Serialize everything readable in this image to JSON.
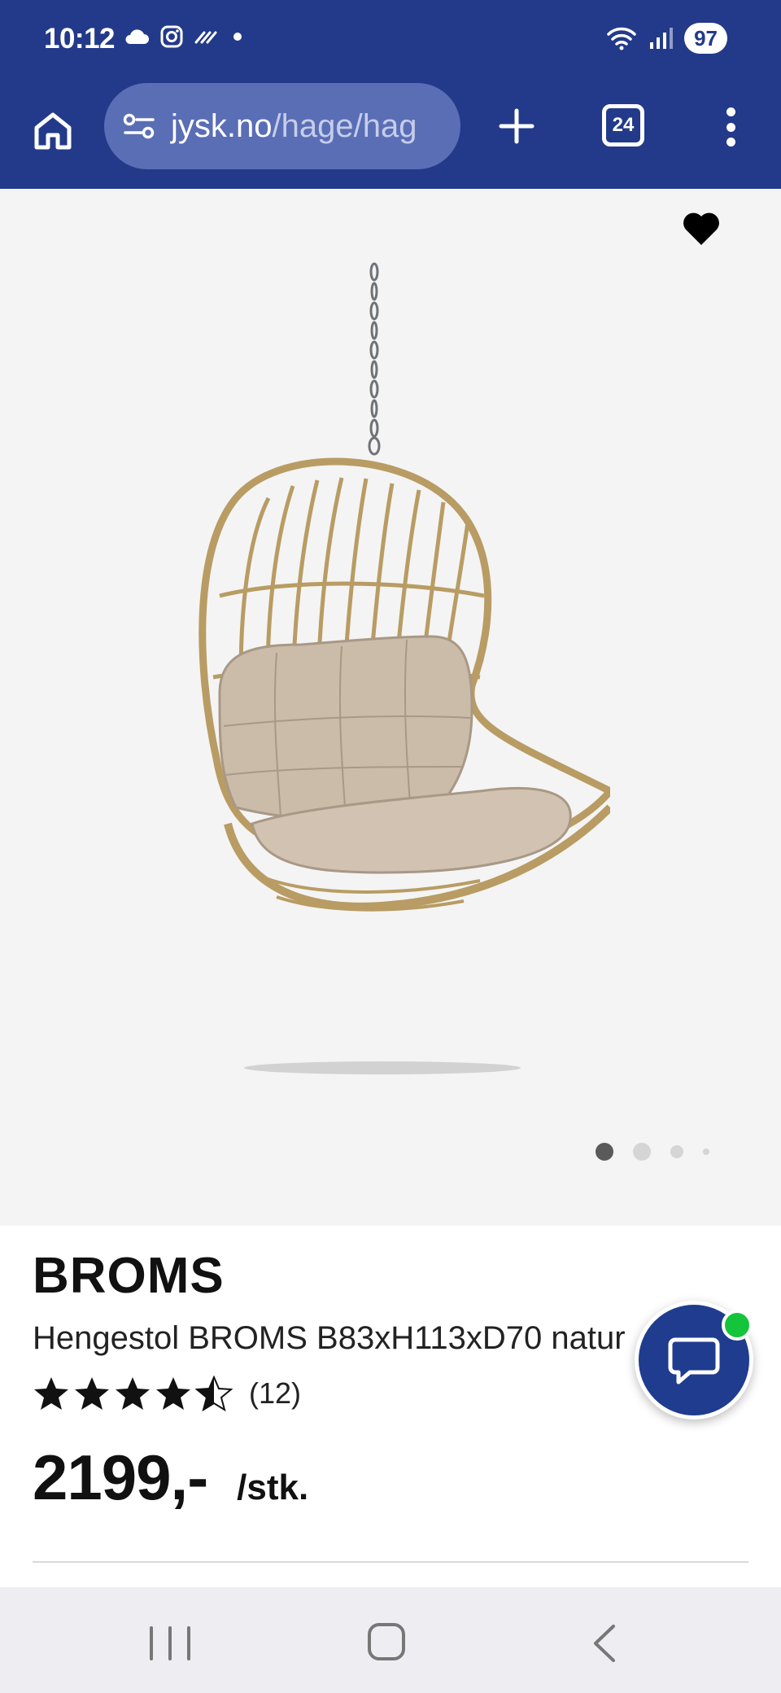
{
  "status_bar": {
    "time": "10:12",
    "battery": "97",
    "icons": [
      "cloud-icon",
      "instagram-icon",
      "wifi-calling-icon",
      "dot-icon",
      "wifi-icon",
      "signal-icon"
    ]
  },
  "browser": {
    "url_domain": "jysk.no",
    "url_path": "/hage/hag",
    "tab_count": "24"
  },
  "product": {
    "brand": "BROMS",
    "name": "Hengestol BROMS B83xH113xD70 natur",
    "rating": 4.5,
    "rating_max": 5,
    "review_count": "(12)",
    "price": "2199,-",
    "unit": "/stk.",
    "image_slides": 4,
    "active_slide": 1
  },
  "colors": {
    "brand_blue": "#233a8a",
    "chat_blue": "#1f3c8f",
    "online_green": "#14c53b",
    "image_bg": "#f4f4f4"
  }
}
